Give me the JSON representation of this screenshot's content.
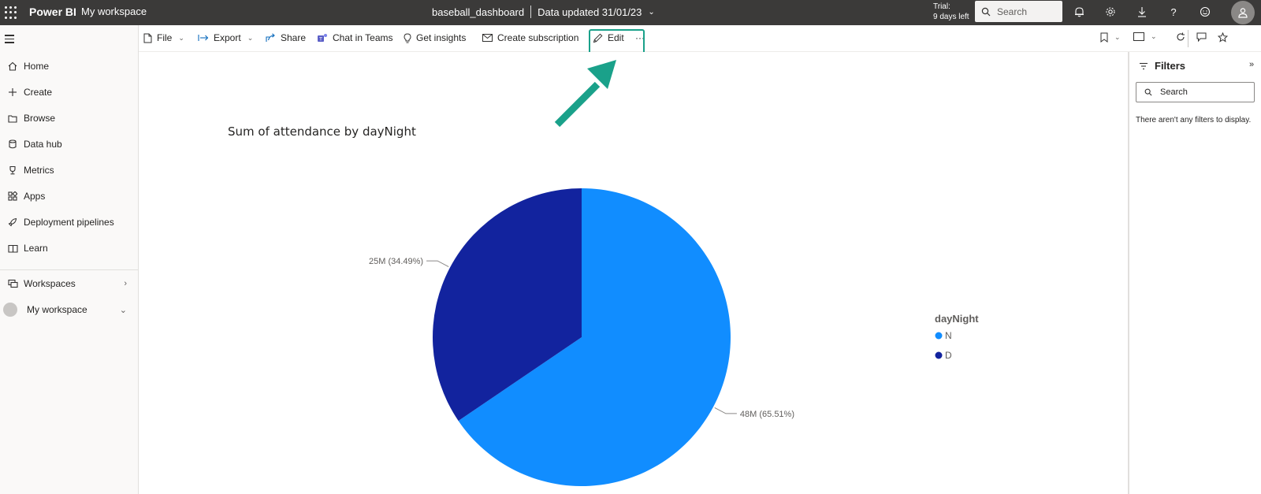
{
  "topbar": {
    "brand": "Power BI",
    "workspace": "My workspace",
    "report_name": "baseball_dashboard",
    "data_updated": "Data updated 31/01/23",
    "trial_line1": "Trial:",
    "trial_line2": "9 days left",
    "search_placeholder": "Search"
  },
  "sidebar": {
    "items": [
      {
        "label": "Home",
        "icon": "home-icon"
      },
      {
        "label": "Create",
        "icon": "plus-icon"
      },
      {
        "label": "Browse",
        "icon": "folder-icon"
      },
      {
        "label": "Data hub",
        "icon": "database-icon"
      },
      {
        "label": "Metrics",
        "icon": "trophy-icon"
      },
      {
        "label": "Apps",
        "icon": "apps-icon"
      },
      {
        "label": "Deployment pipelines",
        "icon": "rocket-icon"
      },
      {
        "label": "Learn",
        "icon": "book-icon"
      }
    ],
    "workspaces": "Workspaces",
    "my_workspace": "My workspace"
  },
  "toolbar": {
    "file": "File",
    "export": "Export",
    "share": "Share",
    "chat_teams": "Chat in Teams",
    "get_insights": "Get insights",
    "create_subscription": "Create subscription",
    "edit": "Edit",
    "more": "···"
  },
  "filters": {
    "title": "Filters",
    "search_placeholder": "Search",
    "empty_message": "There aren't any filters to display."
  },
  "colors": {
    "accent_highlight": "#1aa18a",
    "series_n": "#118dff",
    "series_d": "#12239e"
  },
  "chart_data": {
    "type": "pie",
    "title": "Sum of attendance by dayNight",
    "legend_title": "dayNight",
    "legend_placement": "right",
    "slices": [
      {
        "name": "N",
        "value": 48,
        "label": "48M (65.51%)",
        "percent": 65.51
      },
      {
        "name": "D",
        "value": 25,
        "label": "25M (34.49%)",
        "percent": 34.49
      }
    ]
  }
}
